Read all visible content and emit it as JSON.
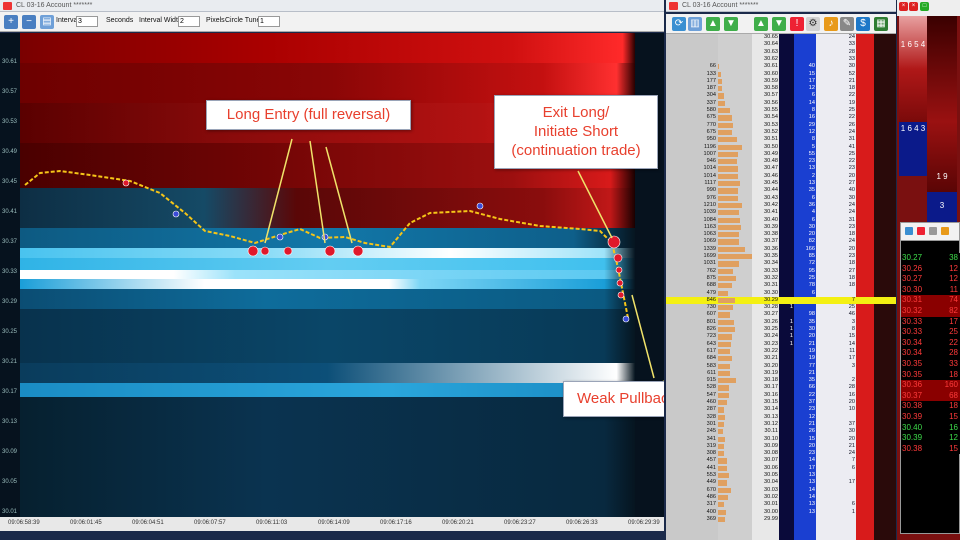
{
  "chart_window": {
    "title": "CL 03-16  Account *******",
    "interval_label": "Interval",
    "interval_value": "3",
    "seconds_label": "Seconds",
    "interval_width_label": "Interval Width",
    "interval_width_value": "2",
    "pixels_label": "Pixels",
    "circle_tuner_label": "Circle Tuner",
    "circle_tuner_value": "1"
  },
  "dom_window": {
    "title": "CL 03-16  Account *******"
  },
  "y_ticks": [
    "30.61",
    "30.57",
    "30.53",
    "30.49",
    "30.45",
    "30.41",
    "30.37",
    "30.33",
    "30.29",
    "30.25",
    "30.21",
    "30.17",
    "30.13",
    "30.09",
    "30.05",
    "30.01"
  ],
  "x_ticks": [
    "09:06:58:39",
    "09:06:01:45",
    "09:06:04:51",
    "09:06:07:57",
    "09:06:11:03",
    "09:06:14:09",
    "09:06:17:16",
    "09:06:20:21",
    "09:06:23:27",
    "09:06:26:33",
    "09:06:29:39"
  ],
  "annotations": {
    "long_entry": "Long Entry (full reversal)",
    "exit_long_1": "Exit Long/",
    "exit_long_2": "Initiate Short",
    "exit_long_3": "(continuation trade)",
    "weak_pullback": "Weak Pullback"
  },
  "ladder": [
    [
      "",
      "30.65",
      "",
      "",
      "24",
      ""
    ],
    [
      "",
      "30.64",
      "",
      "",
      "33",
      ""
    ],
    [
      "",
      "30.63",
      "",
      "",
      "28",
      ""
    ],
    [
      "",
      "30.62",
      "",
      "",
      "33",
      ""
    ],
    [
      "66",
      "30.61",
      "",
      "40",
      "30",
      ""
    ],
    [
      "133",
      "30.60",
      "",
      "15",
      "52",
      ""
    ],
    [
      "177",
      "30.59",
      "",
      "17",
      "21",
      ""
    ],
    [
      "187",
      "30.58",
      "",
      "12",
      "18",
      ""
    ],
    [
      "304",
      "30.57",
      "",
      "6",
      "22",
      ""
    ],
    [
      "337",
      "30.56",
      "",
      "14",
      "19",
      ""
    ],
    [
      "580",
      "30.55",
      "",
      "8",
      "25",
      ""
    ],
    [
      "675",
      "30.54",
      "",
      "16",
      "22",
      ""
    ],
    [
      "770",
      "30.53",
      "",
      "29",
      "26",
      ""
    ],
    [
      "675",
      "30.52",
      "",
      "12",
      "24",
      ""
    ],
    [
      "950",
      "30.51",
      "",
      "8",
      "31",
      ""
    ],
    [
      "1196",
      "30.50",
      "",
      "5",
      "41",
      ""
    ],
    [
      "1007",
      "30.49",
      "",
      "55",
      "25",
      ""
    ],
    [
      "946",
      "30.48",
      "",
      "23",
      "22",
      ""
    ],
    [
      "1014",
      "30.47",
      "",
      "13",
      "23",
      ""
    ],
    [
      "1014",
      "30.46",
      "",
      "2",
      "20",
      ""
    ],
    [
      "1117",
      "30.45",
      "",
      "13",
      "27",
      ""
    ],
    [
      "990",
      "30.44",
      "",
      "35",
      "40",
      ""
    ],
    [
      "976",
      "30.43",
      "",
      "6",
      "30",
      ""
    ],
    [
      "1210",
      "30.42",
      "",
      "36",
      "24",
      ""
    ],
    [
      "1039",
      "30.41",
      "",
      "4",
      "24",
      ""
    ],
    [
      "1084",
      "30.40",
      "",
      "6",
      "31",
      ""
    ],
    [
      "1163",
      "30.39",
      "",
      "30",
      "23",
      ""
    ],
    [
      "1063",
      "30.38",
      "",
      "20",
      "18",
      ""
    ],
    [
      "1069",
      "30.37",
      "",
      "82",
      "24",
      ""
    ],
    [
      "1339",
      "30.36",
      "",
      "166",
      "20",
      ""
    ],
    [
      "1699",
      "30.35",
      "",
      "85",
      "23",
      ""
    ],
    [
      "1031",
      "30.34",
      "",
      "72",
      "18",
      ""
    ],
    [
      "762",
      "30.33",
      "",
      "95",
      "27",
      ""
    ],
    [
      "875",
      "30.32",
      "",
      "25",
      "18",
      ""
    ],
    [
      "688",
      "30.31",
      "",
      "78",
      "18",
      ""
    ],
    [
      "479",
      "30.30",
      "",
      "6",
      "",
      ""
    ],
    [
      "846",
      "30.29",
      "",
      "",
      "7",
      ""
    ],
    [
      "730",
      "30.28",
      "1",
      "",
      "25",
      ""
    ],
    [
      "607",
      "30.27",
      "",
      "98",
      "46",
      ""
    ],
    [
      "801",
      "30.26",
      "1",
      "35",
      "3",
      ""
    ],
    [
      "826",
      "30.25",
      "1",
      "30",
      "8",
      ""
    ],
    [
      "723",
      "30.24",
      "1",
      "20",
      "15",
      ""
    ],
    [
      "643",
      "30.23",
      "1",
      "21",
      "14",
      ""
    ],
    [
      "617",
      "30.22",
      "",
      "19",
      "11",
      ""
    ],
    [
      "684",
      "30.21",
      "",
      "19",
      "17",
      ""
    ],
    [
      "583",
      "30.20",
      "",
      "77",
      "3",
      ""
    ],
    [
      "611",
      "30.19",
      "",
      "21",
      "",
      ""
    ],
    [
      "915",
      "30.18",
      "",
      "35",
      "2",
      ""
    ],
    [
      "528",
      "30.17",
      "",
      "66",
      "28",
      ""
    ],
    [
      "547",
      "30.16",
      "",
      "22",
      "16",
      ""
    ],
    [
      "460",
      "30.15",
      "",
      "37",
      "20",
      ""
    ],
    [
      "287",
      "30.14",
      "",
      "23",
      "10",
      ""
    ],
    [
      "328",
      "30.13",
      "",
      "12",
      "",
      ""
    ],
    [
      "301",
      "30.12",
      "",
      "21",
      "37",
      ""
    ],
    [
      "245",
      "30.11",
      "",
      "26",
      "30",
      ""
    ],
    [
      "341",
      "30.10",
      "",
      "15",
      "20",
      ""
    ],
    [
      "319",
      "30.09",
      "",
      "20",
      "21",
      ""
    ],
    [
      "308",
      "30.08",
      "",
      "23",
      "24",
      ""
    ],
    [
      "457",
      "30.07",
      "",
      "14",
      "7",
      ""
    ],
    [
      "441",
      "30.06",
      "",
      "17",
      "6",
      ""
    ],
    [
      "553",
      "30.05",
      "",
      "13",
      "",
      ""
    ],
    [
      "449",
      "30.04",
      "",
      "13",
      "17",
      ""
    ],
    [
      "670",
      "30.03",
      "",
      "14",
      "",
      ""
    ],
    [
      "486",
      "30.02",
      "",
      "14",
      "",
      ""
    ],
    [
      "317",
      "30.01",
      "",
      "13",
      "6",
      ""
    ],
    [
      "400",
      "30.00",
      "",
      "13",
      "1",
      ""
    ],
    [
      "369",
      "29.99",
      "",
      "",
      "",
      ""
    ]
  ],
  "tape": [
    [
      "30.27",
      "38"
    ],
    [
      "30.26",
      "12"
    ],
    [
      "30.27",
      "12"
    ],
    [
      "30.30",
      "11"
    ],
    [
      "30.31",
      "74"
    ],
    [
      "30.32",
      "82"
    ],
    [
      "30.33",
      "17"
    ],
    [
      "30.33",
      "25"
    ],
    [
      "30.34",
      "22"
    ],
    [
      "30.34",
      "28"
    ],
    [
      "30.35",
      "33"
    ],
    [
      "30.35",
      "18"
    ],
    [
      "30.36",
      "160"
    ],
    [
      "30.37",
      "68"
    ],
    [
      "30.38",
      "18"
    ],
    [
      "30.39",
      "15"
    ],
    [
      "30.40",
      "16"
    ],
    [
      "30.39",
      "12"
    ],
    [
      "30.38",
      "15"
    ]
  ],
  "side_panel": {
    "top_numbers": "1 6 5 4",
    "mid_numbers": "1 6 4 3",
    "low_numbers": "1 9",
    "bottom_number": "3"
  },
  "colors": {
    "bid": "#1a3fd1",
    "ask": "#d81b1b",
    "highlight": "#f4f012",
    "callout_text": "#e8402e"
  }
}
